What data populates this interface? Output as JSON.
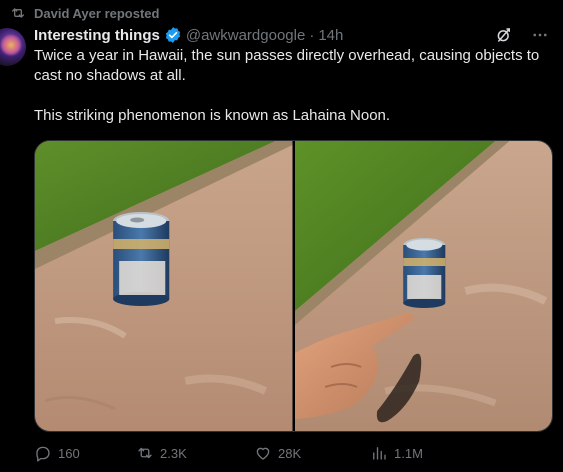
{
  "repost_banner": {
    "text": "David Ayer reposted"
  },
  "author": {
    "name": "Interesting things",
    "handle": "@awkwardgoogle",
    "time": "14h"
  },
  "tweet": {
    "paragraph1": "Twice a year in Hawaii, the sun passes directly overhead, causing objects to cast no shadows at all.",
    "paragraph2": "This striking phenomenon is known as Lahaina Noon."
  },
  "metrics": {
    "replies": "160",
    "reposts": "2.3K",
    "likes": "28K",
    "views": "1.1M"
  },
  "colors": {
    "background": "#000000",
    "text": "#e7e9ea",
    "muted": "#71767b",
    "verified": "#1d9bf0"
  },
  "icons": {
    "repost_banner": "repost-icon",
    "verified": "verified-badge-icon",
    "grok": "grok-icon",
    "more": "more-icon",
    "reply": "reply-icon",
    "repost": "repost-icon",
    "like": "heart-icon",
    "views": "views-icon",
    "bookmark": "bookmark-icon",
    "share": "share-icon"
  }
}
